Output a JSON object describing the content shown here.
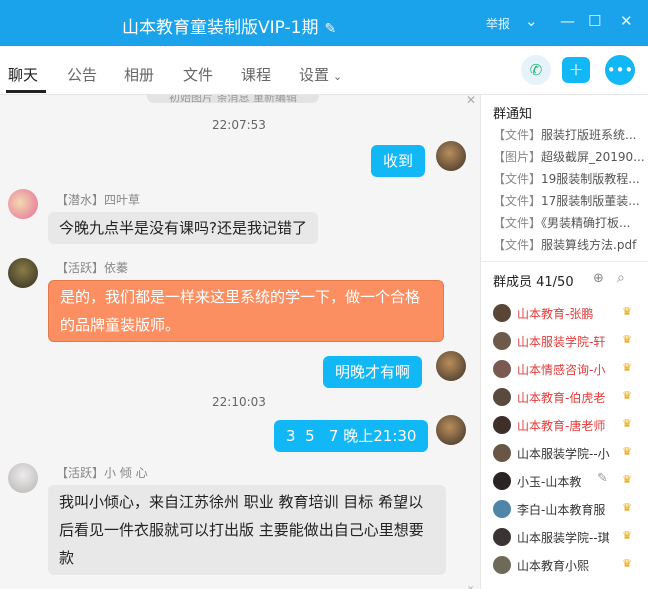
{
  "title": {
    "text": "山本教育童装制版VIP-1期",
    "edit_icon": "✎",
    "report": "举报"
  },
  "tabs": [
    "聊天",
    "公告",
    "相册",
    "文件",
    "课程",
    "设置"
  ],
  "chat": {
    "top_partial": "初始图片    条消息   重新编辑",
    "messages": [
      {
        "time": "22:07:53"
      },
      {
        "me": true,
        "text": "收到"
      },
      {
        "sender": "【潜水】四叶草",
        "text": "今晚九点半是没有课吗?还是我记错了"
      },
      {
        "sender": "【活跃】依蓁",
        "text": "是的，我们都是一样来这里系统的学一下，做一个合格的品牌童装版师。"
      },
      {
        "me": true,
        "text": "明晚才有啊"
      },
      {
        "time": "22:10:03"
      },
      {
        "me": true,
        "text": "3  5   7 晚上21:30"
      },
      {
        "sender": "【活跃】小 倾 心",
        "text": "我叫小倾心，来自江苏徐州 职业 教育培训  目标 希望以后看见一件衣服就可以打出版 主要能做出自己心里想要款"
      }
    ]
  },
  "sidebar": {
    "notice_title": "群通知",
    "notices": [
      {
        "tag": "【文件】",
        "text": "服装打版班系统..."
      },
      {
        "tag": "【图片】",
        "text": "超级截屏_20190..."
      },
      {
        "tag": "【文件】",
        "text": "19服装制版教程..."
      },
      {
        "tag": "【文件】",
        "text": "17服装制版董装..."
      },
      {
        "tag": "【文件】",
        "text": "《男装精确打板..."
      },
      {
        "tag": "【文件】",
        "text": "服装算线方法.pdf"
      }
    ],
    "members_title": "群成员 41/50",
    "members": [
      {
        "name": "山本教育-张鹏",
        "red": true
      },
      {
        "name": "山本服装学院-轩",
        "red": true
      },
      {
        "name": "山本情感咨询-小",
        "red": true
      },
      {
        "name": "山本教育-伯虎老",
        "red": true
      },
      {
        "name": "山本教育-唐老师",
        "red": true
      },
      {
        "name": "山本服装学院--小",
        "red": false
      },
      {
        "name": "小玉-山本教",
        "red": false
      },
      {
        "name": "李白-山本教育服",
        "red": false
      },
      {
        "name": "山本服装学院--琪",
        "red": false
      },
      {
        "name": "山本教育小熙",
        "red": false
      }
    ]
  }
}
